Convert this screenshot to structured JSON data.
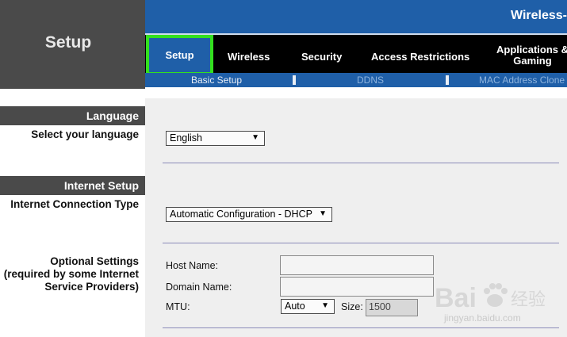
{
  "header": {
    "section_title": "Setup",
    "banner_title": "Wireless-"
  },
  "tabs": [
    {
      "label": "Setup",
      "active": true
    },
    {
      "label": "Wireless"
    },
    {
      "label": "Security"
    },
    {
      "label": "Access Restrictions"
    },
    {
      "label_line1": "Applications &",
      "label_line2": "Gaming"
    }
  ],
  "subtabs": [
    {
      "label": "Basic Setup",
      "active": true
    },
    {
      "label": "DDNS"
    },
    {
      "label": "MAC Address Clone"
    }
  ],
  "sections": {
    "language": {
      "title": "Language",
      "field_label": "Select your language",
      "selected": "English"
    },
    "internet": {
      "title": "Internet Setup",
      "field_label": "Internet Connection Type",
      "selected": "Automatic Configuration - DHCP"
    },
    "optional": {
      "label_line1": "Optional Settings",
      "label_line2": "(required by some Internet",
      "label_line3": "Service Providers)",
      "host_name_label": "Host Name:",
      "host_name_value": "",
      "domain_name_label": "Domain Name:",
      "domain_name_value": "",
      "mtu_label": "MTU:",
      "mtu_selected": "Auto",
      "size_label": "Size:",
      "size_value": "1500"
    }
  },
  "watermark": {
    "brand": "Bai",
    "brand_suffix": "经验",
    "url": "jingyan.baidu.com"
  },
  "colors": {
    "accent_blue": "#1f5fa8",
    "highlight_green": "#33e01f",
    "panel_gray": "#4a4a4a"
  }
}
